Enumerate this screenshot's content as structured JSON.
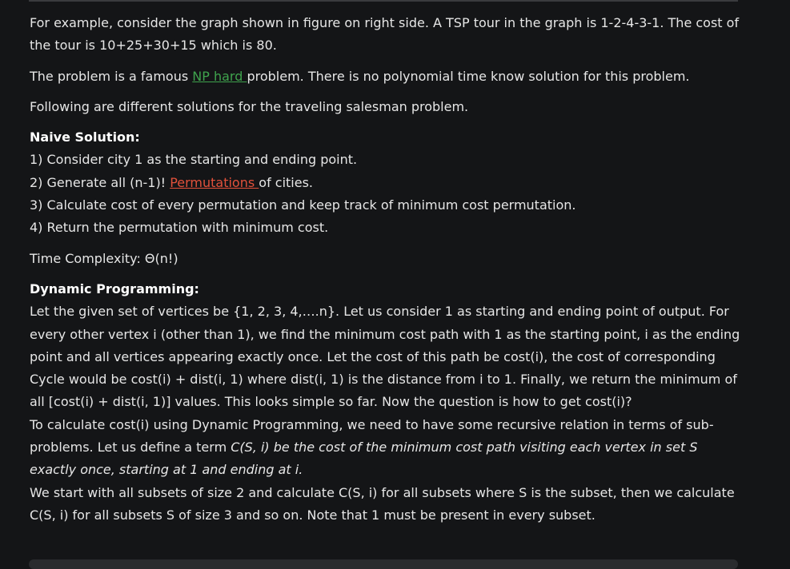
{
  "intro": {
    "example": "For example, consider the graph shown in figure on right side. A TSP tour in the graph is 1-2-4-3-1. The cost of the tour is 10+25+30+15 which is 80.",
    "np_before": "The problem is a famous ",
    "np_link": "NP hard ",
    "np_after": "problem. There is no polynomial time know solution for this problem.",
    "following": "Following are different solutions for the traveling salesman problem."
  },
  "naive": {
    "heading": "Naive Solution:",
    "step1": "1) Consider city 1 as the starting and ending point.",
    "step2_before": "2) Generate all (n-1)! ",
    "step2_link": "Permutations ",
    "step2_after": "of cities.",
    "step3": "3) Calculate cost of every permutation and keep track of minimum cost permutation.",
    "step4": "4) Return the permutation with minimum cost.",
    "complexity": "Time Complexity: Θ(n!)"
  },
  "dp": {
    "heading": "Dynamic Programming:",
    "para1": "Let the given set of vertices be {1, 2, 3, 4,….n}. Let us consider 1 as starting and ending point of output. For every other vertex i (other than 1), we find the minimum cost path with 1 as the starting point, i as the ending point and all vertices appearing exactly once. Let the cost of this path be cost(i), the cost of corresponding Cycle would be cost(i) + dist(i, 1) where dist(i, 1) is the distance from i to 1. Finally, we return the minimum of all [cost(i) + dist(i, 1)] values. This looks simple so far. Now the question is how to get cost(i)?",
    "para2_before": "To calculate cost(i) using Dynamic Programming, we need to have some recursive relation in terms of sub-problems. Let us define a term ",
    "para2_italic": "C(S, i) be the cost of the minimum cost path visiting each vertex in set S exactly once, starting at 1 and ending at i.",
    "para3": "We start with all subsets of size 2 and calculate C(S, i) for all subsets where S is the subset, then we calculate C(S, i) for all subsets S of size 3 and so on. Note that 1 must be present in every subset."
  }
}
